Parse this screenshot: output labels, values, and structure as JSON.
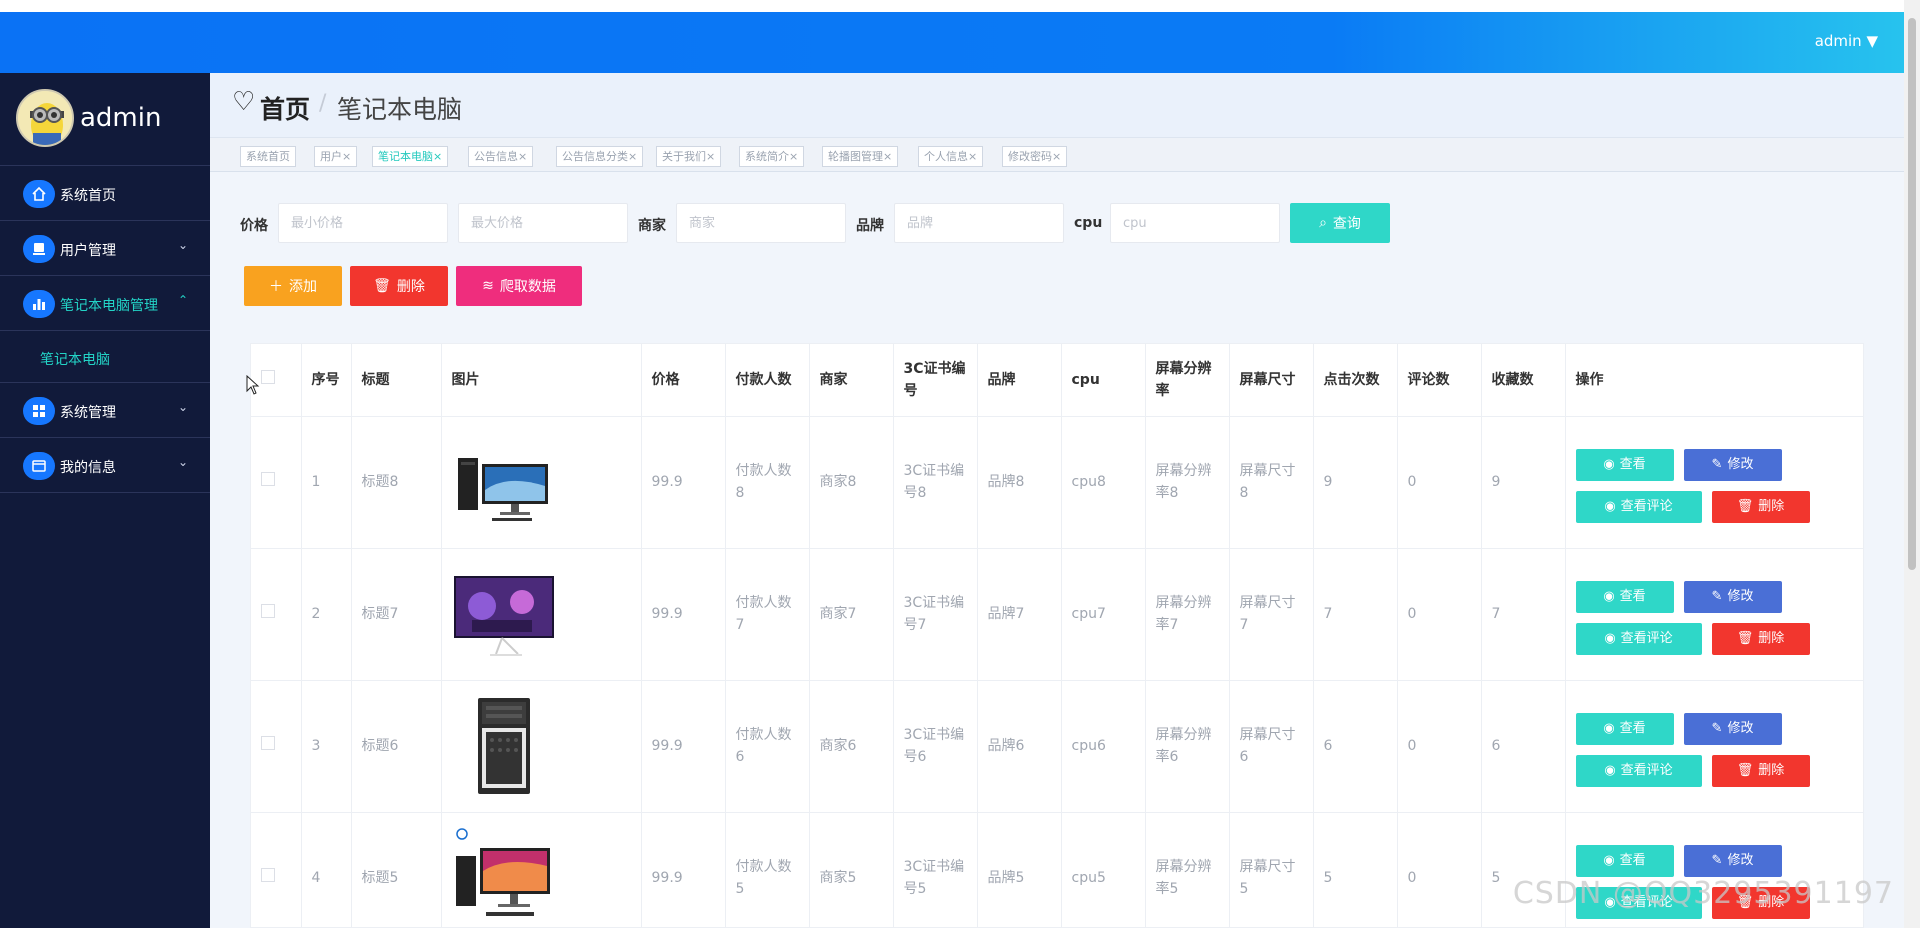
{
  "topbar": {
    "user_label": "admin ▼"
  },
  "sidebar": {
    "brand_name": "admin",
    "items": [
      {
        "label": "系统首页",
        "arrow": ""
      },
      {
        "label": "用户管理",
        "arrow": "⌄"
      },
      {
        "label": "笔记本电脑管理",
        "arrow": "⌃"
      },
      {
        "sub_label": "笔记本电脑"
      },
      {
        "label": "系统管理",
        "arrow": "⌄"
      },
      {
        "label": "我的信息",
        "arrow": "⌄"
      }
    ]
  },
  "page": {
    "home": "首页",
    "sep": "/",
    "current": "笔记本电脑"
  },
  "tags": [
    "系统首页",
    "用户×",
    "笔记本电脑×",
    "公告信息×",
    "公告信息分类×",
    "关于我们×",
    "系统简介×",
    "轮播图管理×",
    "个人信息×",
    "修改密码×"
  ],
  "search": {
    "price_label": "价格",
    "min_placeholder": "最小价格",
    "max_placeholder": "最大价格",
    "merchant_label": "商家",
    "merchant_placeholder": "商家",
    "brand_label": "品牌",
    "brand_placeholder": "品牌",
    "cpu_label": "cpu",
    "cpu_placeholder": "cpu",
    "query_button": "查询"
  },
  "actions": {
    "add": "添加",
    "delete": "删除",
    "crawl": "爬取数据"
  },
  "table": {
    "headers": [
      "序号",
      "标题",
      "图片",
      "价格",
      "付款人数",
      "商家",
      "3C证书编号",
      "品牌",
      "cpu",
      "屏幕分辨率",
      "屏幕尺寸",
      "点击次数",
      "评论数",
      "收藏数",
      "操作"
    ],
    "rows": [
      {
        "no": "1",
        "title": "标题8",
        "price": "99.9",
        "payers": "付款人数8",
        "merchant": "商家8",
        "cert": "3C证书编号8",
        "brand": "品牌8",
        "cpu": "cpu8",
        "res": "屏幕分辨率8",
        "size": "屏幕尺寸8",
        "clicks": "9",
        "comments": "0",
        "favs": "9"
      },
      {
        "no": "2",
        "title": "标题7",
        "price": "99.9",
        "payers": "付款人数7",
        "merchant": "商家7",
        "cert": "3C证书编号7",
        "brand": "品牌7",
        "cpu": "cpu7",
        "res": "屏幕分辨率7",
        "size": "屏幕尺寸7",
        "clicks": "7",
        "comments": "0",
        "favs": "7"
      },
      {
        "no": "3",
        "title": "标题6",
        "price": "99.9",
        "payers": "付款人数6",
        "merchant": "商家6",
        "cert": "3C证书编号6",
        "brand": "品牌6",
        "cpu": "cpu6",
        "res": "屏幕分辨率6",
        "size": "屏幕尺寸6",
        "clicks": "6",
        "comments": "0",
        "favs": "6"
      },
      {
        "no": "4",
        "title": "标题5",
        "price": "99.9",
        "payers": "付款人数5",
        "merchant": "商家5",
        "cert": "3C证书编号5",
        "brand": "品牌5",
        "cpu": "cpu5",
        "res": "屏幕分辨率5",
        "size": "屏幕尺寸5",
        "clicks": "5",
        "comments": "0",
        "favs": "5"
      }
    ],
    "row_buttons": {
      "view": "查看",
      "edit": "修改",
      "view_comments": "查看评论",
      "delete": "删除"
    }
  },
  "watermark": "CSDN @QQ3295391197",
  "colors": {
    "topbar": "#0a72f5",
    "sidebar": "#111a3a",
    "teal": "#2fd7c8",
    "blue": "#4a6fd6",
    "red": "#f2362e",
    "orange": "#f9a21f",
    "pink": "#ef2d7d"
  }
}
